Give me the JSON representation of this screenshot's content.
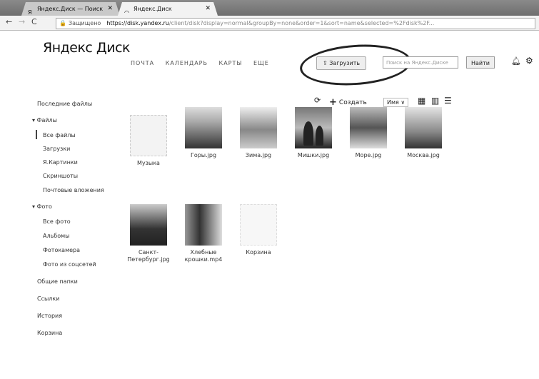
{
  "browser": {
    "tabs": [
      {
        "label": "Яндекс.Диск — Поиск"
      },
      {
        "label": "Яндекс.Диск"
      }
    ],
    "address": {
      "secure_label": "Защищено",
      "host": "https://disk.yandex.ru",
      "path": "/client/disk?display=normal&groupBy=none&order=1&sort=name&selected=%2Fdisk%2F..."
    }
  },
  "header": {
    "logo": "Яндекс Диск",
    "nav": [
      "ПОЧТА",
      "КАЛЕНДАРЬ",
      "КАРТЫ",
      "ЕЩЕ"
    ],
    "upload_label": "Загрузить",
    "search_placeholder": "Поиск на Яндекс.Диске",
    "find_label": "Найти"
  },
  "toolbar": {
    "create_label": "Создать",
    "sort_label": "Имя ∨"
  },
  "sidebar": {
    "recent": "Последние файлы",
    "files_header": "Файлы",
    "files": [
      "Все файлы",
      "Загрузки",
      "Я.Картинки",
      "Скриншоты",
      "Почтовые вложения"
    ],
    "photo_header": "Фото",
    "photo": [
      "Все фото",
      "Альбомы",
      "Фотокамера",
      "Фото из соцсетей"
    ],
    "bottom": [
      "Общие папки",
      "Ссылки",
      "История",
      "Корзина"
    ]
  },
  "files": [
    {
      "name": "Музыка",
      "kind": "folder"
    },
    {
      "name": "Горы.jpg",
      "kind": "image"
    },
    {
      "name": "Зима.jpg",
      "kind": "image"
    },
    {
      "name": "Мишки.jpg",
      "kind": "image"
    },
    {
      "name": "Море.jpg",
      "kind": "image"
    },
    {
      "name": "Москва.jpg",
      "kind": "image"
    },
    {
      "name": "Санкт-Петербург.jpg",
      "kind": "image"
    },
    {
      "name": "Хлебные крошки.mp4",
      "kind": "video"
    },
    {
      "name": "Корзина",
      "kind": "trash"
    }
  ]
}
